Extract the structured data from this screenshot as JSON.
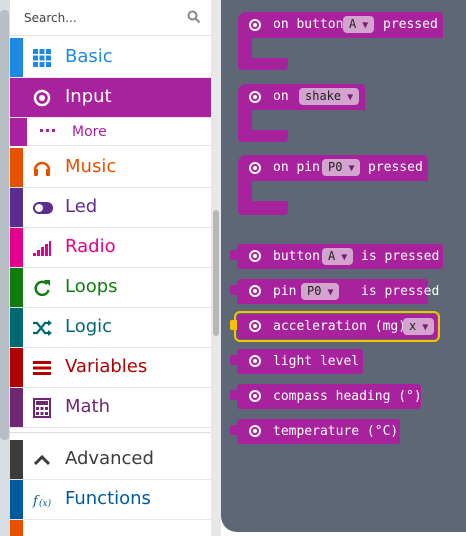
{
  "search": {
    "placeholder": "Search..."
  },
  "toolbox": {
    "categories": [
      {
        "label": "Basic",
        "color": "#1e88e5",
        "icon": "grid-icon"
      },
      {
        "label": "Input",
        "color": "#a8219d",
        "icon": "radio-target-icon",
        "selected": true
      },
      {
        "label": "Music",
        "color": "#e65100",
        "icon": "headphones-icon"
      },
      {
        "label": "Led",
        "color": "#5c2d91",
        "icon": "toggle-icon"
      },
      {
        "label": "Radio",
        "color": "#e3008c",
        "icon": "signal-bars-icon"
      },
      {
        "label": "Loops",
        "color": "#107c10",
        "icon": "refresh-icon"
      },
      {
        "label": "Logic",
        "color": "#006970",
        "icon": "shuffle-icon"
      },
      {
        "label": "Variables",
        "color": "#b00000",
        "icon": "lines-icon"
      },
      {
        "label": "Math",
        "color": "#712672",
        "icon": "calculator-icon"
      }
    ],
    "more": {
      "label": "More",
      "icon": "dots-icon"
    },
    "advanced": [
      {
        "label": "Advanced",
        "color": "#3c3c3c",
        "icon": "chevron-up-icon"
      },
      {
        "label": "Functions",
        "color": "#005a9e",
        "icon": "fx-icon"
      }
    ]
  },
  "flyout": {
    "hat_blocks": [
      {
        "prefix": "on button",
        "dropdown": "A",
        "suffix": "pressed"
      },
      {
        "prefix": "on",
        "dropdown": "shake",
        "suffix": ""
      },
      {
        "prefix": "on pin",
        "dropdown": "P0",
        "suffix": "pressed"
      }
    ],
    "value_blocks": [
      {
        "prefix": "button",
        "dropdown": "A",
        "suffix": "is pressed"
      },
      {
        "prefix": "pin",
        "dropdown": "P0",
        "suffix": "is pressed"
      },
      {
        "prefix": "acceleration (mg)",
        "dropdown": "x",
        "suffix": "",
        "selected": true
      },
      {
        "prefix": "light level",
        "dropdown": "",
        "suffix": ""
      },
      {
        "prefix": "compass heading (°)",
        "dropdown": "",
        "suffix": ""
      },
      {
        "prefix": "temperature (°C)",
        "dropdown": "",
        "suffix": ""
      }
    ]
  }
}
